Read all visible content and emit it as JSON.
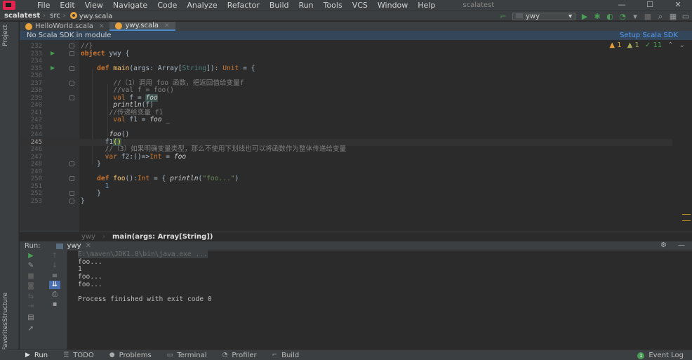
{
  "menubar": {
    "items": [
      "File",
      "Edit",
      "View",
      "Navigate",
      "Code",
      "Analyze",
      "Refactor",
      "Build",
      "Run",
      "Tools",
      "VCS",
      "Window",
      "Help"
    ],
    "title": "scalatest",
    "controls": [
      "—",
      "☐",
      "✕"
    ]
  },
  "navbar": {
    "project": "scalatest",
    "folder": "src",
    "file": "ywy.scala",
    "run_config": "ywy"
  },
  "left_strip": {
    "project_label": "Project",
    "structure_label": "Structure",
    "favorites_label": "Favorites"
  },
  "editor_tabs": [
    {
      "label": "HelloWorld.scala"
    },
    {
      "label": "ywy.scala"
    }
  ],
  "banner": {
    "message": "No Scala SDK in module",
    "action": "Setup Scala SDK"
  },
  "inspection": {
    "warnings": "1",
    "weak_warnings": "1",
    "typos": "11"
  },
  "editor": {
    "line_numbers": [
      "232",
      "233",
      "234",
      "235",
      "236",
      "237",
      "238",
      "239",
      "240",
      "241",
      "242",
      "243",
      "244",
      "245",
      "246",
      "247",
      "248",
      "249",
      "250",
      "251",
      "252",
      "253"
    ],
    "current_line": "245",
    "lines": {
      "l232": "//}",
      "l233_kw": "object",
      "l233_rest": " ywy {",
      "l235_def": "def",
      "l235_name": "main",
      "l235_args": "(args: ",
      "l235_array": "Array",
      "l235_lb": "[",
      "l235_string": "String",
      "l235_rb": "]): ",
      "l235_unit": "Unit",
      "l235_end": " = {",
      "l237": "//（1）调用 foo 函数，把返回值给变量f",
      "l238": "//val f = foo()",
      "l239_val": "val",
      "l239_mid": " f = ",
      "l239_foo": "foo",
      "l240_println": "println",
      "l240_rest": "(f)",
      "l241": "//传递给变量 f1",
      "l242_val": "val",
      "l242_mid": " f1 = ",
      "l242_foo": "foo",
      "l242_end": " _",
      "l244_foo": "foo",
      "l244_end": "()",
      "l245_f1": "f1",
      "l245_paren": "()",
      "l246": "//（3）如果明确变量类型，那么不使用下划线也可以将函数作为整体传递给变量",
      "l247_var": "var",
      "l247_mid": " f2:()=>",
      "l247_int": "Int",
      "l247_eq": " = ",
      "l247_foo": "foo",
      "l248": "}",
      "l250_def": "def",
      "l250_name": "foo",
      "l250_mid": "():",
      "l250_int": "Int",
      "l250_eq": " = { ",
      "l250_println": "println",
      "l250_lp": "(",
      "l250_str": "\"foo...\"",
      "l250_rp": ")",
      "l251": "1",
      "l252": "}",
      "l253": "}"
    }
  },
  "editor_breadcrumb": {
    "object": "ywy",
    "method": "main(args: Array[String])"
  },
  "run_window": {
    "title": "Run:",
    "tab": "ywy",
    "console": [
      "E:\\maven\\JDK1.8\\bin\\java.exe ...",
      "foo...",
      "1",
      "foo...",
      "foo...",
      "",
      "Process finished with exit code 0"
    ]
  },
  "bottom_strip": {
    "tabs": [
      "Run",
      "TODO",
      "Problems",
      "Terminal",
      "Profiler",
      "Build"
    ],
    "event_log": "Event Log",
    "event_badge": "1"
  },
  "colors": {
    "keyword": "#cc7832",
    "comment": "#808080",
    "function": "#ffc66d",
    "string": "#6a8759",
    "number": "#6897bb",
    "run_green": "#499c54",
    "banner_bg": "#34475a",
    "link_blue": "#589df6"
  }
}
